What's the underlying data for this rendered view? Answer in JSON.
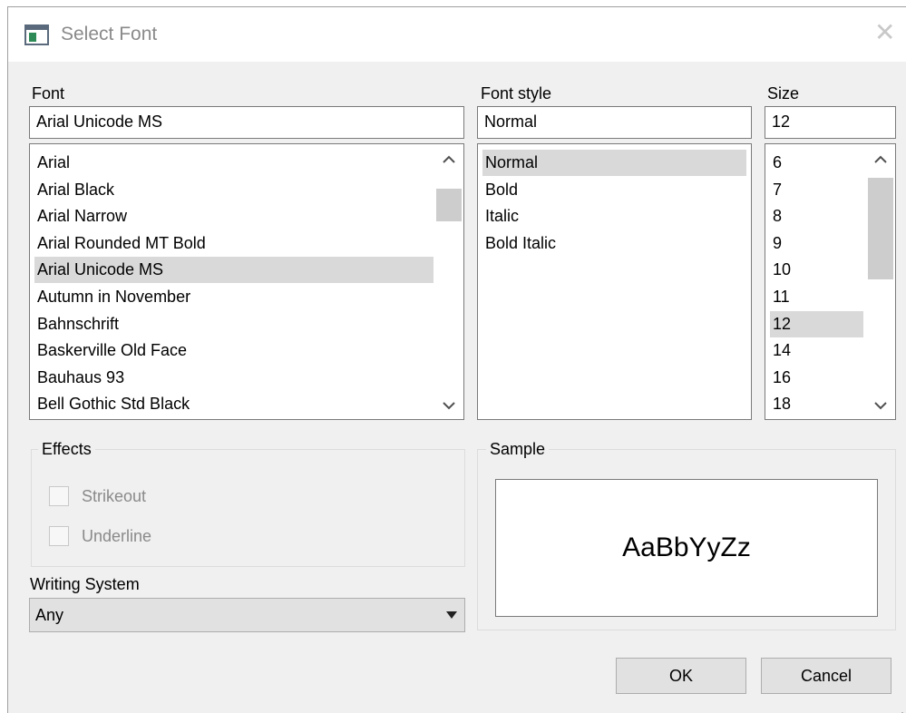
{
  "window": {
    "title": "Select Font",
    "close_glyph": "✕"
  },
  "font": {
    "label": "Font",
    "value": "Arial Unicode MS",
    "items": [
      "Arial",
      "Arial Black",
      "Arial Narrow",
      "Arial Rounded MT Bold",
      "Arial Unicode MS",
      "Autumn in November",
      "Bahnschrift",
      "Baskerville Old Face",
      "Bauhaus 93",
      "Bell Gothic Std Black"
    ],
    "selected": "Arial Unicode MS"
  },
  "style": {
    "label": "Font style",
    "value": "Normal",
    "items": [
      "Normal",
      "Bold",
      "Italic",
      "Bold Italic"
    ],
    "selected": "Normal"
  },
  "size": {
    "label": "Size",
    "value": "12",
    "items": [
      "6",
      "7",
      "8",
      "9",
      "10",
      "11",
      "12",
      "14",
      "16",
      "18"
    ],
    "selected": "12"
  },
  "effects": {
    "title": "Effects",
    "strikeout_label": "Strikeout",
    "strikeout_checked": false,
    "underline_label": "Underline",
    "underline_checked": false
  },
  "writing_system": {
    "label": "Writing System",
    "value": "Any"
  },
  "sample": {
    "title": "Sample",
    "text": "AaBbYyZz"
  },
  "buttons": {
    "ok": "OK",
    "cancel": "Cancel"
  },
  "icons": {
    "app": "window-app-icon",
    "close": "close-icon",
    "up": "chevron-up-icon",
    "down": "chevron-down-icon",
    "dropdown": "dropdown-arrow-icon",
    "grip": "resize-grip-icon"
  },
  "colors": {
    "selection": "#d9d9d9",
    "dialog_bg": "#f0f0f0",
    "disabled_text": "#8a8a8a"
  }
}
